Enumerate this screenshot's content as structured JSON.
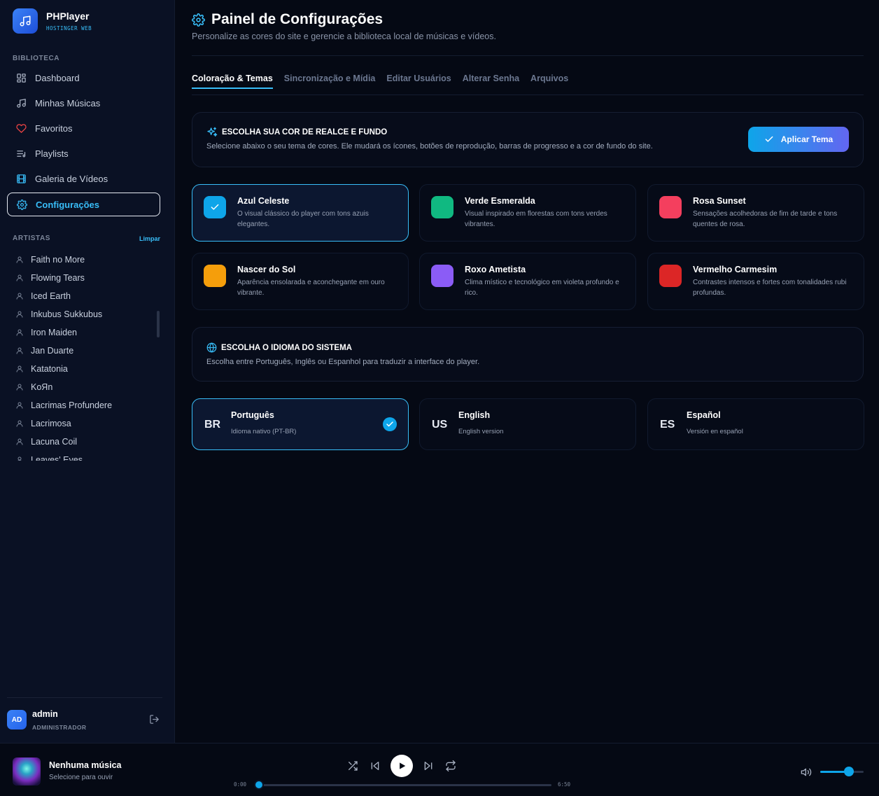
{
  "brand": {
    "name": "PHPlayer",
    "subtitle": "HOSTINGER WEB"
  },
  "sidebar": {
    "library_label": "BIBLIOTECA",
    "nav": [
      {
        "label": "Dashboard",
        "icon": "dashboard-icon"
      },
      {
        "label": "Minhas Músicas",
        "icon": "music-note-icon"
      },
      {
        "label": "Favoritos",
        "icon": "heart-icon"
      },
      {
        "label": "Playlists",
        "icon": "playlist-icon"
      },
      {
        "label": "Galeria de Vídeos",
        "icon": "film-icon"
      },
      {
        "label": "Configurações",
        "icon": "gear-icon",
        "active": true
      }
    ],
    "artists_label": "ARTISTAS",
    "clear_label": "Limpar",
    "artists": [
      "Faith no More",
      "Flowing Tears",
      "Iced Earth",
      "Inkubus Sukkubus",
      "Iron Maiden",
      "Jan Duarte",
      "Katatonia",
      "KoЯn",
      "Lacrimas Profundere",
      "Lacrimosa",
      "Lacuna Coil",
      "Leaves' Eyes"
    ]
  },
  "user": {
    "initials": "AD",
    "name": "admin",
    "role": "ADMINISTRADOR"
  },
  "page": {
    "title": "Painel de Configurações",
    "subtitle": "Personalize as cores do site e gerencie a biblioteca local de músicas e vídeos.",
    "tabs": [
      {
        "label": "Coloração & Temas",
        "active": true
      },
      {
        "label": "Sincronização e Mídia"
      },
      {
        "label": "Editar Usuários"
      },
      {
        "label": "Alterar Senha"
      },
      {
        "label": "Arquivos"
      }
    ]
  },
  "theme_panel": {
    "title": "ESCOLHA SUA COR DE REALCE E FUNDO",
    "description": "Selecione abaixo o seu tema de cores. Ele mudará os ícones, botões de reprodução, barras de progresso e a cor de fundo do site.",
    "apply_label": "Aplicar Tema"
  },
  "themes": [
    {
      "name": "Azul Celeste",
      "description": "O visual clássico do player com tons azuis elegantes.",
      "color": "#0ea5e9",
      "selected": true
    },
    {
      "name": "Verde Esmeralda",
      "description": "Visual inspirado em florestas com tons verdes vibrantes.",
      "color": "#10b981"
    },
    {
      "name": "Rosa Sunset",
      "description": "Sensações acolhedoras de fim de tarde e tons quentes de rosa.",
      "color": "#f43f5e"
    },
    {
      "name": "Nascer do Sol",
      "description": "Aparência ensolarada e aconchegante em ouro vibrante.",
      "color": "#f59e0b"
    },
    {
      "name": "Roxo Ametista",
      "description": "Clima místico e tecnológico em violeta profundo e rico.",
      "color": "#8b5cf6"
    },
    {
      "name": "Vermelho Carmesim",
      "description": "Contrastes intensos e fortes com tonalidades rubi profundas.",
      "color": "#dc2626"
    }
  ],
  "language_panel": {
    "title": "ESCOLHA O IDIOMA DO SISTEMA",
    "description": "Escolha entre Português, Inglês ou Espanhol para traduzir a interface do player."
  },
  "languages": [
    {
      "code": "BR",
      "name": "Português",
      "description": "Idioma nativo (PT-BR)",
      "selected": true
    },
    {
      "code": "US",
      "name": "English",
      "description": "English version"
    },
    {
      "code": "ES",
      "name": "Español",
      "description": "Versión en español"
    }
  ],
  "player": {
    "title": "Nenhuma música",
    "subtitle": "Selecione para ouvir",
    "time_current": "0:00",
    "time_total": "6:50",
    "progress": 0,
    "volume": 0.7
  },
  "colors": {
    "accent": "#0ea5e9",
    "background": "#050914",
    "sidebar": "#0a1124"
  }
}
